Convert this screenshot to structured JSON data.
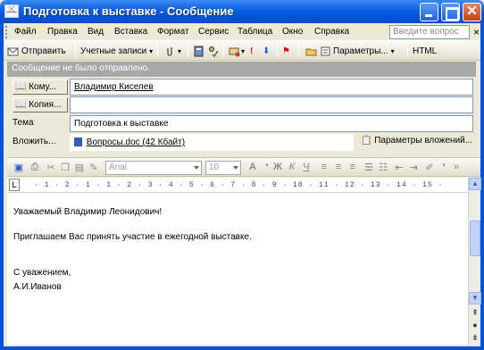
{
  "window": {
    "title": "Подготовка к выставке - Сообщение",
    "minimize_label": "",
    "maximize_label": "",
    "close_label": "✕"
  },
  "menu": {
    "items": [
      "Файл",
      "Правка",
      "Вид",
      "Вставка",
      "Формат",
      "Сервис",
      "Таблица",
      "Окно",
      "Справка"
    ],
    "help_placeholder": "Введите вопрос",
    "help_close": "×"
  },
  "toolbar": {
    "send_label": "Отправить",
    "accounts_label": "Учетные записи",
    "options_label": "Параметры...",
    "format_label": "HTML"
  },
  "header": {
    "notice": "Сообщение не было отправлено.",
    "to_label": "Кому...",
    "to_value": "Владимир Киселев",
    "cc_label": "Копия...",
    "cc_value": "",
    "subject_label": "Тема",
    "subject_value": "Подготовка к выставке",
    "attach_label": "Вложить...",
    "attach_file": "Вопросы.doc (42 Кбайт)",
    "attach_options": "Параметры вложений..."
  },
  "format_bar": {
    "font": "Arial",
    "size": "10",
    "bold": "Ж",
    "italic": "К",
    "underline": "Ч"
  },
  "ruler": {
    "marks": "· 1 · 2 · 1 · 1 · 2 · 3 · 4 · 5 · 6 · 7 · 8 · 9 · 10 · 11 · 12 · 13 · 14 · 15 ·"
  },
  "body": {
    "greeting": "Уважаемый Владимир Леонидович!",
    "line1": "Приглашаем Вас принять участие в ежегодной выставке.",
    "closing": "С уважением,",
    "signature": "А.И.Иванов"
  },
  "colors": {
    "titlebar": "#0A5FE0",
    "frame": "#0453D8",
    "notice_bg": "#A8A8A8",
    "chrome": "#ECE9D8"
  }
}
